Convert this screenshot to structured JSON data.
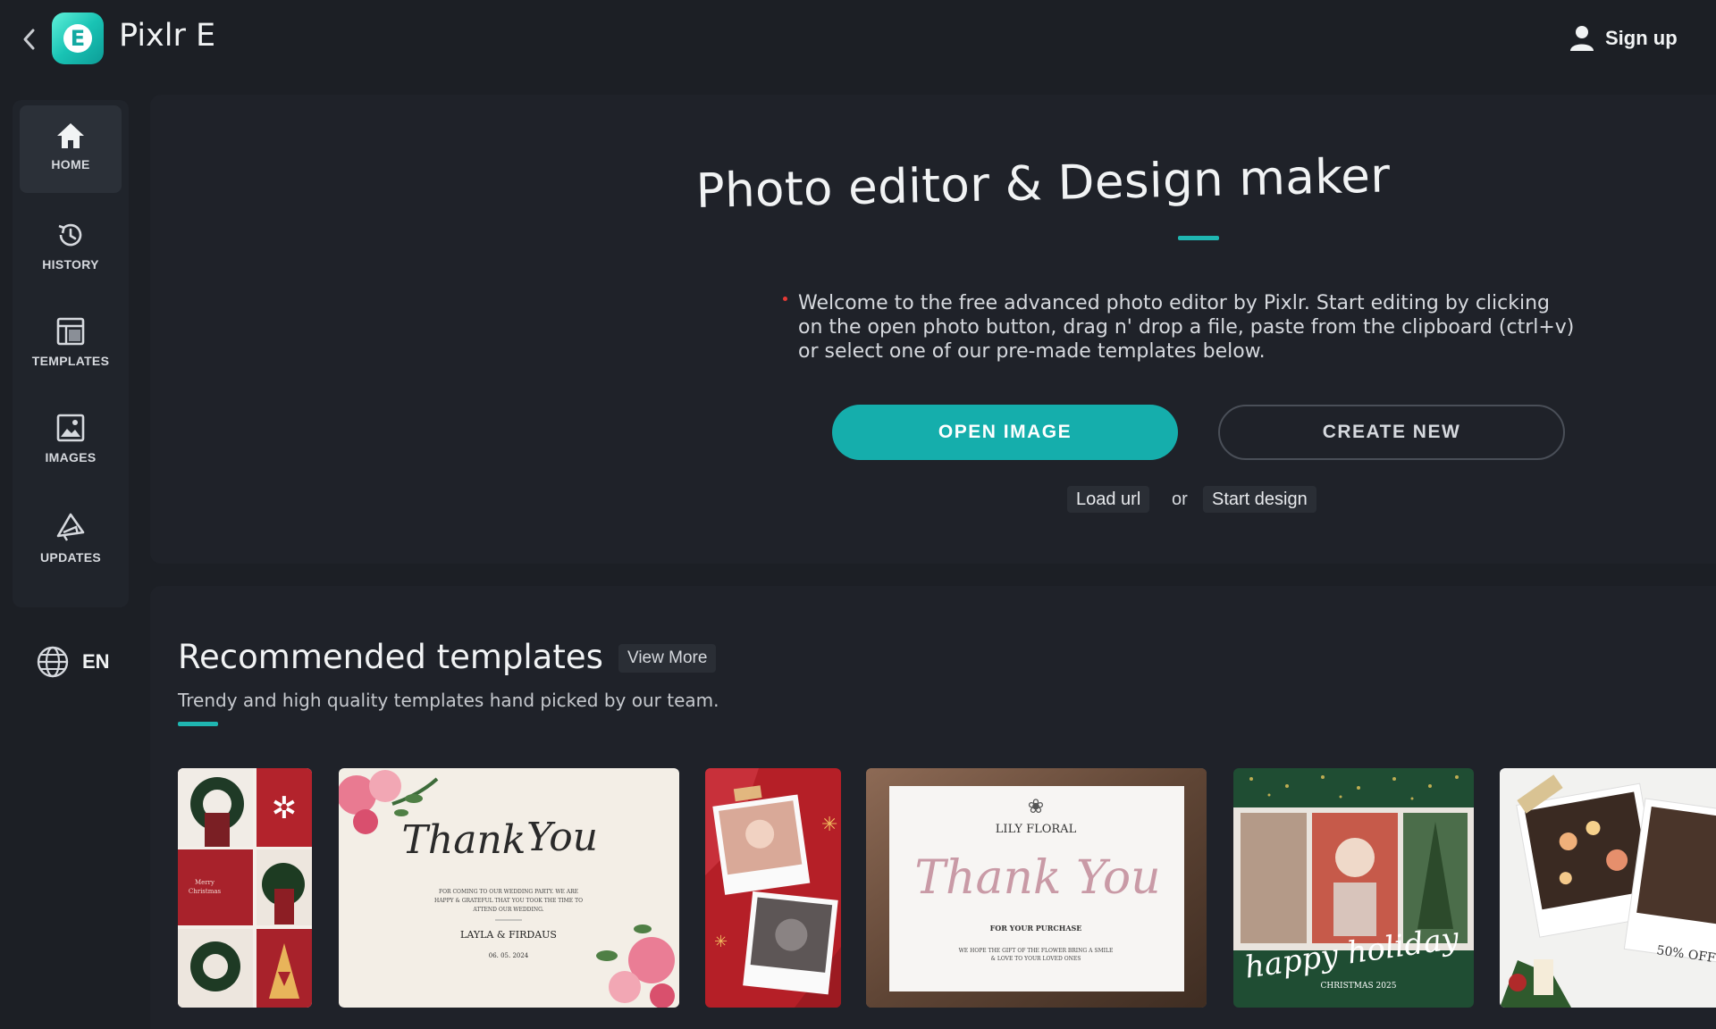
{
  "app": {
    "title": "Pixlr E",
    "logo_letter": "E"
  },
  "header": {
    "signup_label": "Sign up"
  },
  "sidebar": {
    "items": [
      {
        "label": "HOME",
        "icon": "home-icon"
      },
      {
        "label": "HISTORY",
        "icon": "history-icon"
      },
      {
        "label": "TEMPLATES",
        "icon": "templates-icon"
      },
      {
        "label": "IMAGES",
        "icon": "images-icon"
      },
      {
        "label": "UPDATES",
        "icon": "updates-icon"
      }
    ],
    "language": "EN"
  },
  "hero": {
    "title": "Photo editor & Design maker",
    "description_lines": [
      "Welcome to the free advanced photo editor by Pixlr. Start editing by clicking",
      "on the open photo button, drag n' drop a file, paste from the clipboard (ctrl+v)",
      "or select one of our pre-made templates below."
    ],
    "open_image_label": "OPEN IMAGE",
    "create_new_label": "CREATE NEW",
    "load_url_label": "Load url",
    "or_label": "or",
    "start_design_label": "Start design"
  },
  "templates": {
    "title": "Recommended templates",
    "view_more_label": "View More",
    "subtitle": "Trendy and high quality templates hand picked by our team.",
    "cards": [
      {
        "name": "Merry Christmas collage",
        "texts": [
          "Merry",
          "Christmas"
        ]
      },
      {
        "name": "Thank You wedding card",
        "texts": [
          "Thank",
          "You",
          "FOR COMING TO OUR WEDDING PARTY. WE ARE",
          "HAPPY & GRATEFUL THAT YOU TOOK THE TIME TO",
          "ATTEND OUR WEDDING.",
          "LAYLA & FIRDAUS",
          "06. 05. 2024"
        ]
      },
      {
        "name": "Red Christmas polaroid",
        "texts": []
      },
      {
        "name": "Lily Floral thank you",
        "texts": [
          "LILY FLORAL",
          "Thank You",
          "FOR YOUR PURCHASE",
          "WE HOPE THE GIFT OF THE FLOWER BRING A SMILE",
          "& LOVE TO YOUR LOVED ONES"
        ]
      },
      {
        "name": "Happy holiday collage",
        "texts": [
          "happy holiday",
          "CHRISTMAS 2025"
        ]
      },
      {
        "name": "Christmas sale polaroid",
        "texts": [
          "50% OFF"
        ]
      }
    ]
  },
  "colors": {
    "accent": "#15aeac",
    "background": "#1c1f25",
    "panel": "#1f2229"
  }
}
